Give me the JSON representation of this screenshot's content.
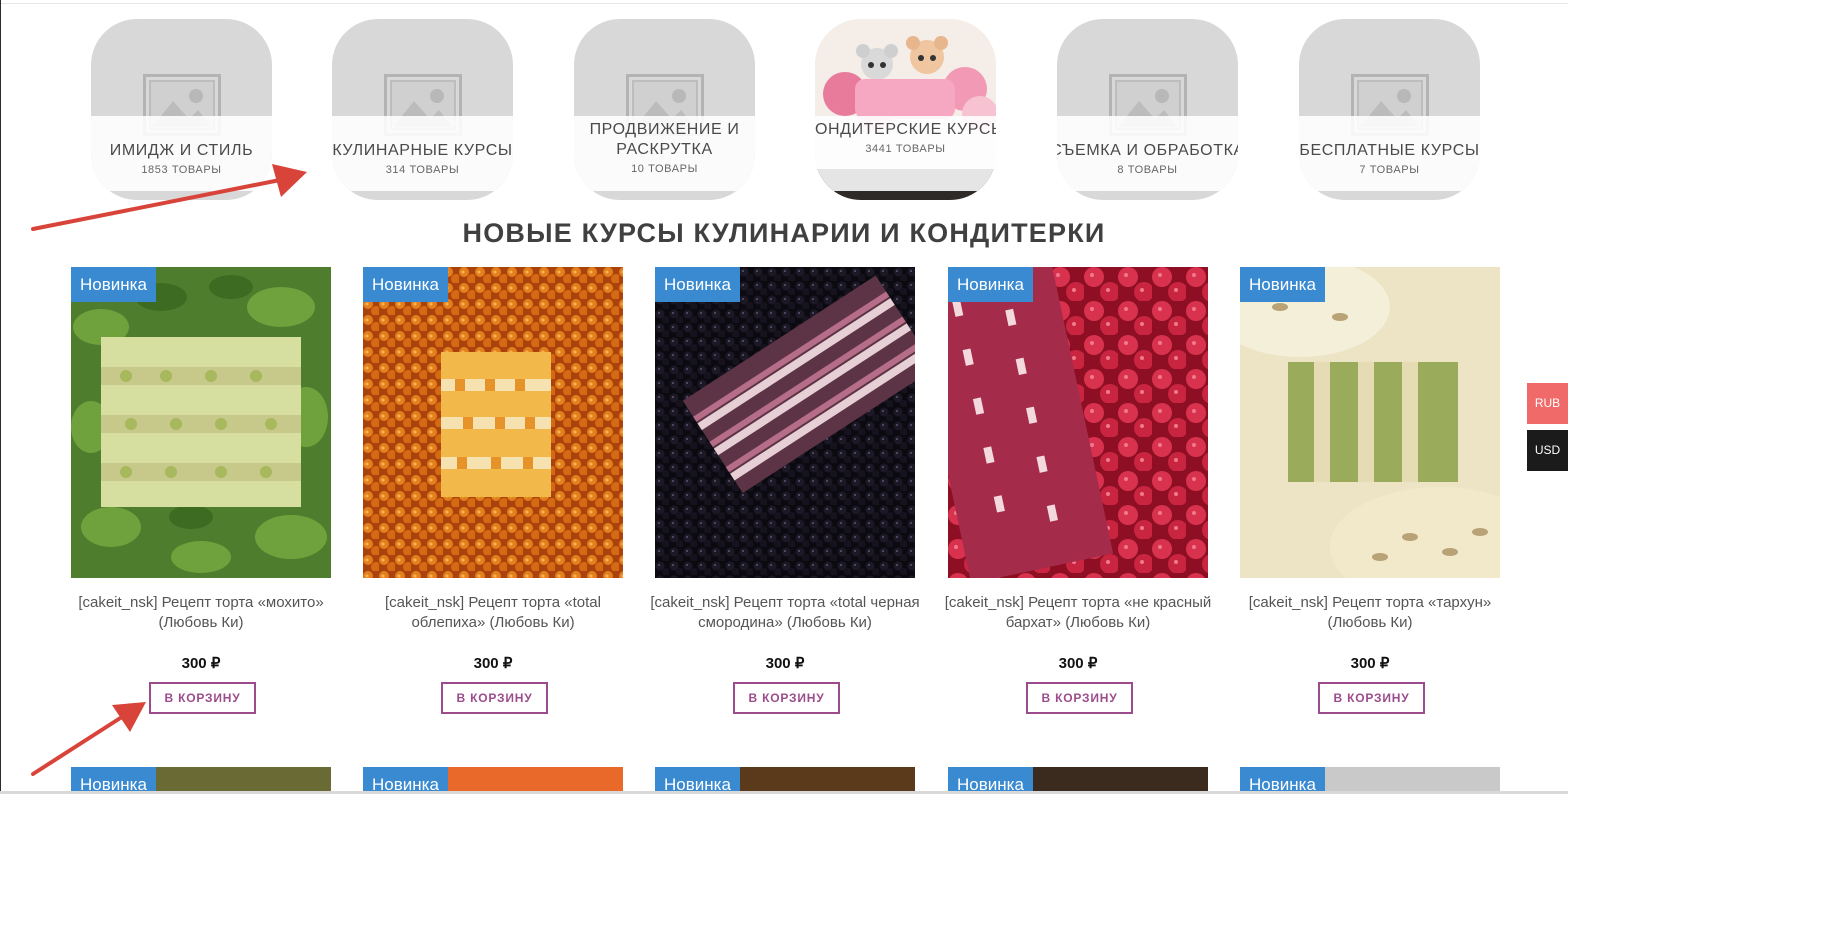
{
  "categories": [
    {
      "name": "ИМИДЖ И СТИЛЬ",
      "count": "1853 ТОВАРЫ",
      "image": "placeholder-icon"
    },
    {
      "name": "КУЛИНАРНЫЕ КУРСЫ",
      "count": "314 ТОВАРЫ",
      "image": "placeholder-icon"
    },
    {
      "name": "ПРОДВИЖЕНИЕ И РАСКРУТКА",
      "count": "10 ТОВАРЫ",
      "image": "placeholder-icon"
    },
    {
      "name": "КОНДИТЕРСКИЕ КУРСЫ",
      "count": "3441 ТОВАРЫ",
      "image": "teddy-bear-cake-photo"
    },
    {
      "name": "СЪЕМКА И ОБРАБОТКА",
      "count": "8 ТОВАРЫ",
      "image": "placeholder-icon"
    },
    {
      "name": "БЕСПЛАТНЫЕ КУРСЫ",
      "count": "7 ТОВАРЫ",
      "image": "placeholder-icon"
    }
  ],
  "section_title": "НОВЫЕ КУРСЫ КУЛИНАРИИ И КОНДИТЕРКИ",
  "products": [
    {
      "badge": "Новинка",
      "title": "[cakeit_nsk] Рецепт торта «мохито» (Любовь Ки)",
      "price": "300 ₽",
      "button": "В КОРЗИНУ",
      "image": "mojito-cake-photo"
    },
    {
      "badge": "Новинка",
      "title": "[cakeit_nsk] Рецепт торта «total облепиха» (Любовь Ки)",
      "price": "300 ₽",
      "button": "В КОРЗИНУ",
      "image": "sea-buckthorn-cake-photo"
    },
    {
      "badge": "Новинка",
      "title": "[cakeit_nsk] Рецепт торта «total черная смородина» (Любовь Ки)",
      "price": "300 ₽",
      "button": "В КОРЗИНУ",
      "image": "blackcurrant-cake-photo"
    },
    {
      "badge": "Новинка",
      "title": "[cakeit_nsk] Рецепт торта «не красный бархат» (Любовь Ки)",
      "price": "300 ₽",
      "button": "В КОРЗИНУ",
      "image": "red-velvet-cake-photo"
    },
    {
      "badge": "Новинка",
      "title": "[cakeit_nsk] Рецепт торта «тархун» (Любовь Ки)",
      "price": "300 ₽",
      "button": "В КОРЗИНУ",
      "image": "tarragon-cake-photo"
    }
  ],
  "products_row2": [
    {
      "badge": "Новинка"
    },
    {
      "badge": "Новинка"
    },
    {
      "badge": "Новинка"
    },
    {
      "badge": "Новинка"
    },
    {
      "badge": "Новинка"
    }
  ],
  "currency": {
    "rub": "RUB",
    "usd": "USD"
  },
  "colors": {
    "badge": "#3a8ad1",
    "button": "#9c4c8c",
    "rub": "#f06a6a",
    "usd": "#1b1b1b",
    "arrow": "#d9443a"
  }
}
